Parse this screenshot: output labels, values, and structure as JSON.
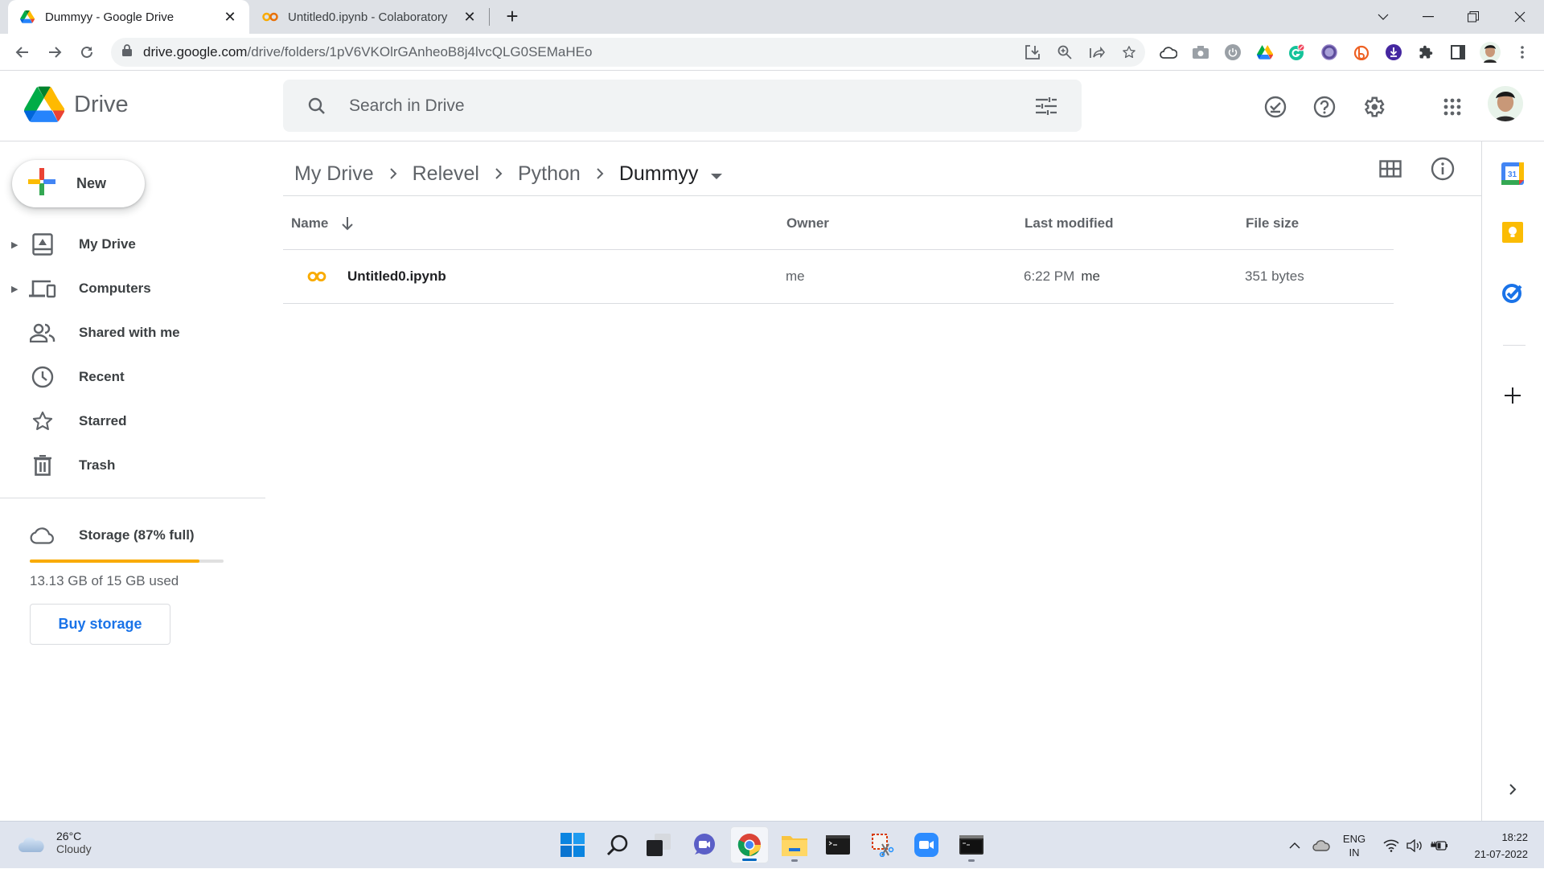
{
  "browser": {
    "tabs": [
      {
        "title": "Dummyy - Google Drive",
        "favicon": "google-drive-icon",
        "active": true
      },
      {
        "title": "Untitled0.ipynb - Colaboratory",
        "favicon": "colab-icon",
        "active": false
      }
    ],
    "url_host": "drive.google.com",
    "url_path": "/drive/folders/1pV6VKOlrGAnheoB8j4lvcQLG0SEMaHEo",
    "omnibox_icons": [
      "install-icon",
      "zoom-icon",
      "share-icon",
      "bookmark-star-icon"
    ],
    "extensions": [
      "cloud-extension-icon",
      "camera-extension-icon",
      "power-extension-icon",
      "google-drive-extension-icon",
      "grammarly-extension-icon",
      "purple-extension-icon",
      "bitly-extension-icon",
      "download-extension-icon",
      "extensions-puzzle-icon",
      "side-panel-icon",
      "profile-avatar",
      "menu-kebab-icon"
    ],
    "window_controls": [
      "tab-search",
      "minimize",
      "restore",
      "close"
    ]
  },
  "drive": {
    "app_name": "Drive",
    "search_placeholder": "Search in Drive",
    "header_icons": [
      "offline-ready-icon",
      "help-icon",
      "settings-icon",
      "apps-grid-icon"
    ],
    "new_button": "New",
    "nav": [
      {
        "label": "My Drive",
        "icon": "my-drive-icon",
        "expandable": true
      },
      {
        "label": "Computers",
        "icon": "computers-icon",
        "expandable": true
      },
      {
        "label": "Shared with me",
        "icon": "shared-icon",
        "expandable": false
      },
      {
        "label": "Recent",
        "icon": "clock-icon",
        "expandable": false
      },
      {
        "label": "Starred",
        "icon": "star-icon",
        "expandable": false
      },
      {
        "label": "Trash",
        "icon": "trash-icon",
        "expandable": false
      }
    ],
    "storage": {
      "label": "Storage (87% full)",
      "used_fraction": 0.875,
      "used_text": "13.13 GB of 15 GB used",
      "buy_label": "Buy storage",
      "bar_color": "#f9ab00"
    },
    "breadcrumb": [
      "My Drive",
      "Relevel",
      "Python",
      "Dummyy"
    ],
    "columns": {
      "name": "Name",
      "owner": "Owner",
      "modified": "Last modified",
      "size": "File size"
    },
    "sort": {
      "column": "Name",
      "direction": "descending-arrow"
    },
    "files": [
      {
        "name": "Untitled0.ipynb",
        "icon": "colab-icon",
        "owner": "me",
        "modified": "6:22 PM",
        "modified_by": "me",
        "size": "351 bytes"
      }
    ],
    "side_panel": [
      "calendar-icon",
      "keep-icon",
      "tasks-icon",
      "add-addon-icon"
    ],
    "calendar_day": "31"
  },
  "taskbar": {
    "weather_temp": "26°C",
    "weather_desc": "Cloudy",
    "apps": [
      "start",
      "search",
      "task-view",
      "teams-chat",
      "chrome",
      "file-explorer",
      "terminal",
      "snipping-tool",
      "zoom",
      "command-prompt"
    ],
    "lang_top": "ENG",
    "lang_bottom": "IN",
    "time": "18:22",
    "date": "21-07-2022"
  }
}
